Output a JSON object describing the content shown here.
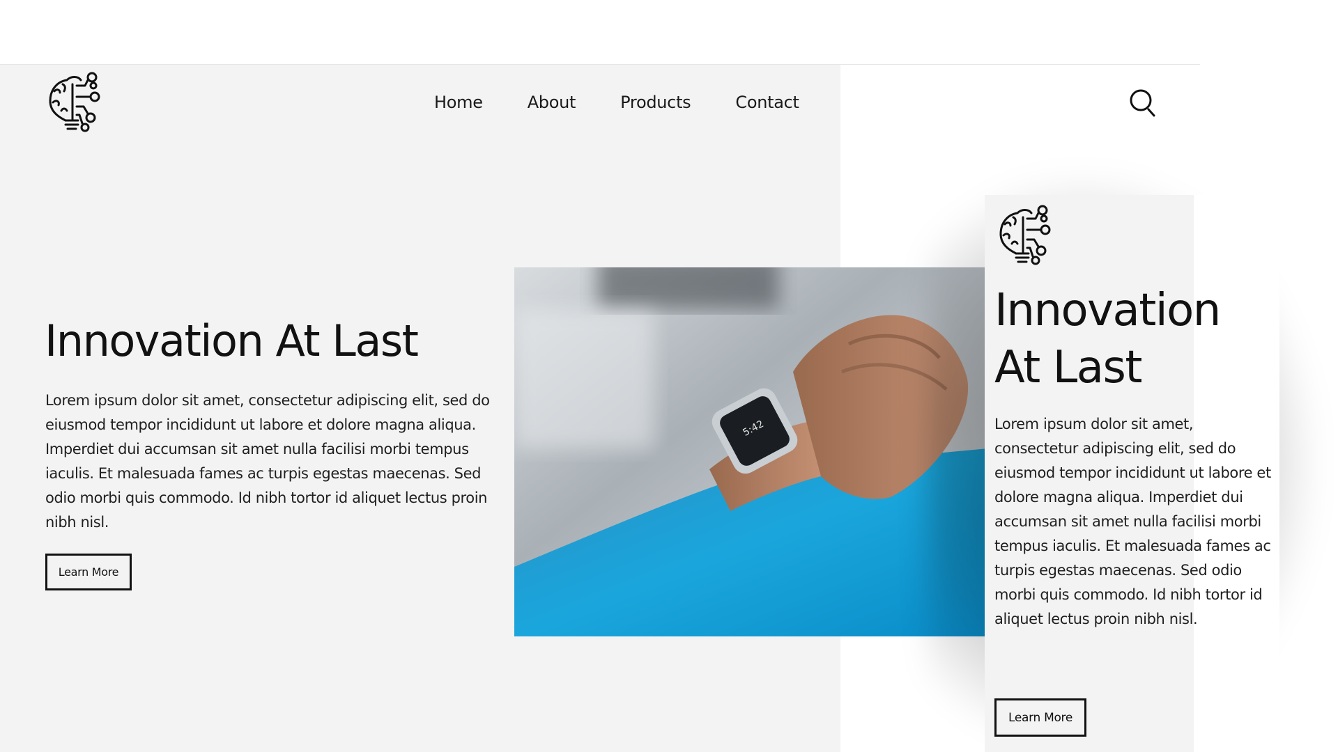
{
  "desktop": {
    "nav": [
      "Home",
      "About",
      "Products",
      "Contact"
    ],
    "hero": {
      "title": "Innovation At Last",
      "body": "Lorem ipsum dolor sit amet, consectetur adipiscing elit, sed do eiusmod tempor incididunt ut labore et dolore magna aliqua. Imperdiet dui accumsan sit amet nulla facilisi morbi tempus iaculis. Et malesuada fames ac turpis egestas maecenas. Sed odio morbi quis commodo. Id nibh tortor id aliquet lectus proin nibh nisl.",
      "button_label": "Learn More"
    },
    "icons": {
      "logo": "brain-lightbulb-circuit-icon",
      "search": "search-icon"
    },
    "image": "smartwatch-on-wrist-photo"
  },
  "mobile": {
    "title": "Innovation At Last",
    "body": "Lorem ipsum dolor sit amet, consectetur adipiscing elit, sed do eiusmod tempor incididunt ut labore et dolore magna aliqua. Imperdiet dui accumsan sit amet nulla facilisi morbi tempus iaculis. Et malesuada fames ac turpis egestas maecenas. Sed odio morbi quis commodo. Id nibh tortor id aliquet lectus proin nibh nisl.",
    "button_label": "Learn More"
  },
  "colors": {
    "panel_gray": "#f3f3f3",
    "text": "#111111",
    "sleeve_blue": "#1e9fd6"
  }
}
